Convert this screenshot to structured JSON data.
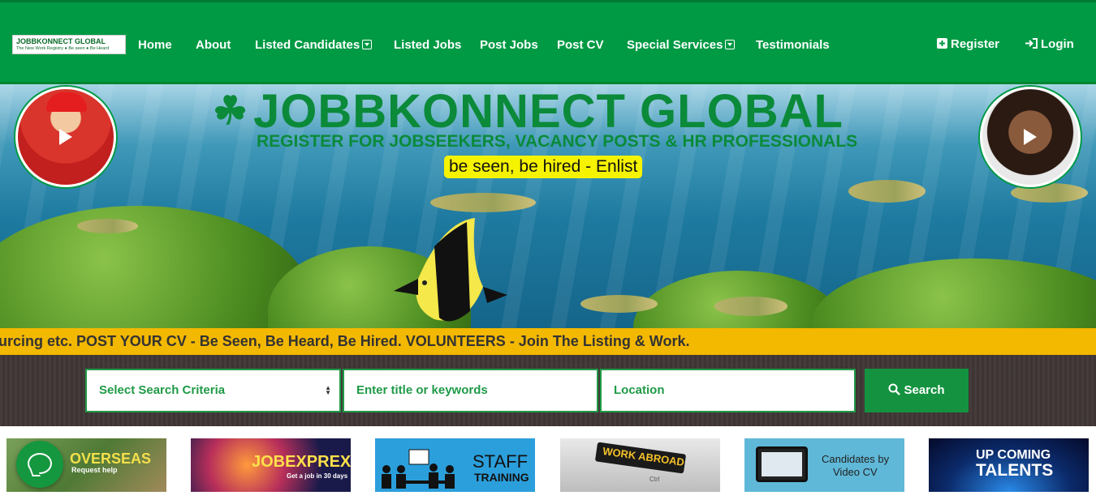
{
  "brand": {
    "name": "JOBBKONNECT GLOBAL",
    "tagline": "The New Work Registry ● Be seen ● Be Heard"
  },
  "nav": {
    "home": "Home",
    "about": "About",
    "listed_candidates": "Listed Candidates",
    "listed_jobs": "Listed Jobs",
    "post_jobs": "Post Jobs",
    "post_cv": "Post CV",
    "special_services": "Special Services",
    "testimonials": "Testimonials",
    "register": "Register",
    "login": "Login"
  },
  "hero": {
    "title": "JOBBKONNECT GLOBAL",
    "subtitle": "REGISTER FOR JOBSEEKERS, VACANCY POSTS & HR PROFESSIONALS",
    "tagline": "be seen, be hired - Enlist"
  },
  "ticker": {
    "text": "urcing etc. POST YOUR CV - Be Seen, Be Heard, Be Hired. VOLUNTEERS - Join The Listing & Work."
  },
  "search": {
    "criteria_selected": "Select Search Criteria",
    "keywords_placeholder": "Enter title or keywords",
    "location_placeholder": "Location",
    "button_label": "Search"
  },
  "tiles": [
    {
      "title": "OVERSEAS",
      "subtitle": "Request help"
    },
    {
      "title": "JOBEXPREXX",
      "subtitle": "Get a job in 30 days"
    },
    {
      "title": "STAFF",
      "subtitle": "TRAINING"
    },
    {
      "title": "WORK ABROAD",
      "subtitle": "Ctrl"
    },
    {
      "title": "Candidates by",
      "subtitle": "Video CV"
    },
    {
      "title": "UP COMING",
      "subtitle": "TALENTS"
    }
  ],
  "colors": {
    "brand_green": "#009a44",
    "ticker_yellow": "#f3b800",
    "tag_yellow": "#f5f300"
  }
}
